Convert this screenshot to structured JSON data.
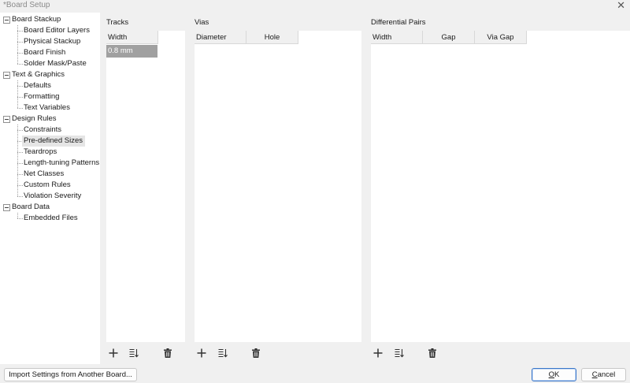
{
  "window": {
    "title": "*Board Setup",
    "close_icon": "close-icon"
  },
  "tree": {
    "groups": [
      {
        "label": "Board Stackup",
        "items": [
          "Board Editor Layers",
          "Physical Stackup",
          "Board Finish",
          "Solder Mask/Paste"
        ]
      },
      {
        "label": "Text & Graphics",
        "items": [
          "Defaults",
          "Formatting",
          "Text Variables"
        ]
      },
      {
        "label": "Design Rules",
        "items": [
          "Constraints",
          "Pre-defined Sizes",
          "Teardrops",
          "Length-tuning Patterns",
          "Net Classes",
          "Custom Rules",
          "Violation Severity"
        ]
      },
      {
        "label": "Board Data",
        "items": [
          "Embedded Files"
        ]
      }
    ],
    "selected": "Pre-defined Sizes"
  },
  "tracks": {
    "label": "Tracks",
    "columns": [
      "Width"
    ],
    "rows": [
      [
        "0.8 mm"
      ]
    ]
  },
  "vias": {
    "label": "Vias",
    "columns": [
      "Diameter",
      "Hole"
    ],
    "rows": []
  },
  "diff_pairs": {
    "label": "Differential Pairs",
    "columns": [
      "Width",
      "Gap",
      "Via Gap"
    ],
    "rows": []
  },
  "toolbar_icons": {
    "add": "plus-icon",
    "sort": "sort-icon",
    "delete": "trash-icon"
  },
  "buttons": {
    "import": "Import Settings from Another Board...",
    "ok_u": "O",
    "ok_rest": "K",
    "cancel_u": "C",
    "cancel_rest": "ancel"
  }
}
